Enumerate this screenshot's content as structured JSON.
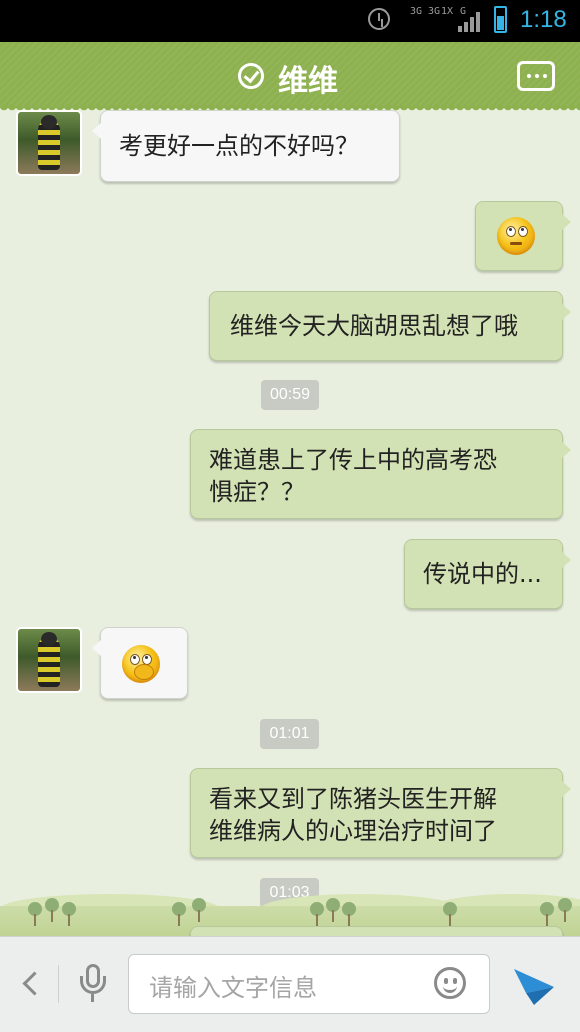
{
  "status_bar": {
    "net_labels": [
      "3G",
      "3G",
      "1X",
      "G"
    ],
    "time": "1:18"
  },
  "header": {
    "title": "维维"
  },
  "chat": {
    "messages": [
      {
        "side": "in",
        "type": "text",
        "text": "考更好一点的不好吗？"
      },
      {
        "side": "out",
        "type": "emoji",
        "emoji": "rolling-eyes-emoji"
      },
      {
        "side": "out",
        "type": "text",
        "text": "维维今天大脑胡思乱想了哦"
      },
      {
        "side": "out",
        "type": "text",
        "lines": [
          "难道患上了传上中的高考恐",
          "惧症？？"
        ]
      },
      {
        "side": "out",
        "type": "text",
        "text": "传说中的..."
      },
      {
        "side": "in",
        "type": "emoji",
        "emoji": "thinking-emoji"
      },
      {
        "side": "out",
        "type": "text",
        "lines": [
          "看来又到了陈猪头医生开解",
          "维维病人的心理治疗时间了"
        ]
      }
    ],
    "timestamps": [
      "00:59",
      "01:01",
      "01:03"
    ]
  },
  "input_bar": {
    "placeholder": "请输入文字信息"
  },
  "colors": {
    "header_green": "#8db14f",
    "outgoing_bubble": "#d3e2b4",
    "incoming_bubble": "#f7f7f7",
    "background": "#e9efdf",
    "send_blue": "#2d8ed6"
  }
}
